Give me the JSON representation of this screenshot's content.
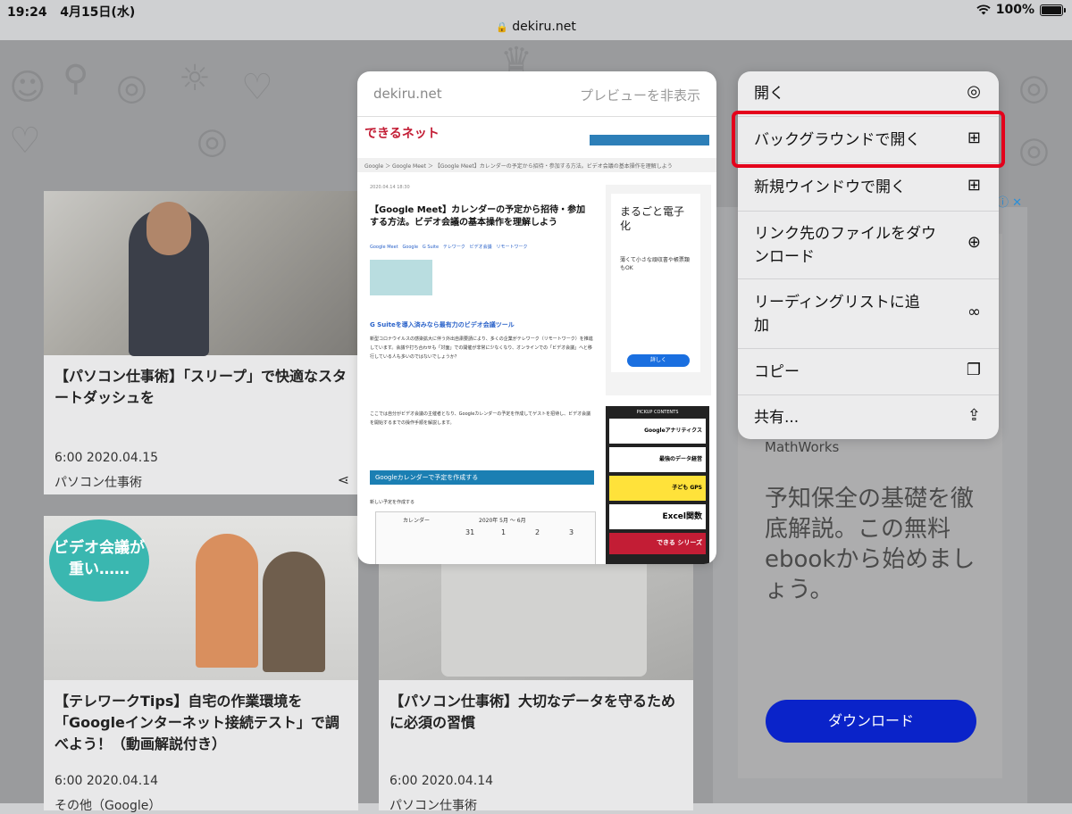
{
  "status": {
    "time": "19:24",
    "date": "4月15日(水)",
    "battery": "100%"
  },
  "url": "dekiru.net",
  "cards": [
    {
      "title": "【パソコン仕事術】「スリープ」で快適なスタートダッシュを",
      "date": "6:00 2020.04.15",
      "category": "パソコン仕事術"
    },
    {
      "title": "【テレワークTips】自宅の作業環境を「Googleインターネット接続テスト」で調べよう！（動画解説付き）",
      "date": "6:00 2020.04.14",
      "category": "その他（Google）",
      "badge": "ビデオ会議が重い……"
    },
    {
      "title": "【パソコン仕事術】大切なデータを守るために必須の習慣",
      "date": "6:00 2020.04.14",
      "category": "パソコン仕事術"
    }
  ],
  "ad": {
    "brand": "MathWorks",
    "text": "予知保全の基礎を徹底解説。この無料ebookから始めましょう。",
    "button": "ダウンロード"
  },
  "preview": {
    "domain": "dekiru.net",
    "hide_label": "プレビューを非表示",
    "site_logo": "できるネット",
    "breadcrumb": "Google ＞ Google Meet ＞ 【Google Meet】カレンダーの予定から招待・参加する方法。ビデオ会議の基本操作を理解しよう",
    "article_date": "2020.04.14 18:30",
    "article_title": "【Google Meet】カレンダーの予定から招待・参加する方法。ビデオ会議の基本操作を理解しよう",
    "tags": [
      "Google Meet",
      "Google",
      "G Suite",
      "テレワーク",
      "ビデオ会議",
      "リモートワーク"
    ],
    "section_heading": "G Suiteを導入済みなら最有力のビデオ会議ツール",
    "body": "新型コロナウイルスの感染拡大に伴う外出自粛要請により、多くの企業がテレワーク（リモートワーク）を推進しています。会議や打ち合わせも「対面」での開催が非常に少なくなり、オンラインでの「ビデオ会議」へと移行している人も多いのではないでしょうか？",
    "body2": "ここでは自分がビデオ会議の主催者となり、Googleカレンダーの予定を作成してゲストを招待し、ビデオ会議を開始するまでの操作手順を解説します。",
    "blue_bar": "Googleカレンダーで予定を作成する",
    "step1": "新しい予定を作成する",
    "cal_label": "カレンダー",
    "cal_range": "2020年 5月 〜 6月",
    "cal_days": [
      "31",
      "1",
      "2",
      "3"
    ],
    "side_ad_title": "まるごと電子化",
    "side_ad_text": "薄くて小さな頑収書や帳票類もOK",
    "side_ad_btn": "詳しく",
    "pickup": "PICKUP CONTENTS",
    "pickup_items": [
      "Googleアナリティクス",
      "最強のデータ経営",
      "子ども GPS",
      "Excel関数",
      "できる シリーズ"
    ]
  },
  "menu": [
    {
      "label": "開く",
      "icon": "compass-icon",
      "glyph": "◎"
    },
    {
      "label": "バックグラウンドで開く",
      "icon": "plus-square-icon",
      "glyph": "⊞"
    },
    {
      "label": "新規ウインドウで開く",
      "icon": "plus-square-icon",
      "glyph": "⊞"
    },
    {
      "label": "リンク先のファイルをダウンロード",
      "icon": "download-icon",
      "glyph": "⊕"
    },
    {
      "label": "リーディングリストに追加",
      "icon": "glasses-icon",
      "glyph": "∞"
    },
    {
      "label": "コピー",
      "icon": "copy-icon",
      "glyph": "❐"
    },
    {
      "label": "共有...",
      "icon": "share-icon",
      "glyph": "⇪"
    }
  ]
}
